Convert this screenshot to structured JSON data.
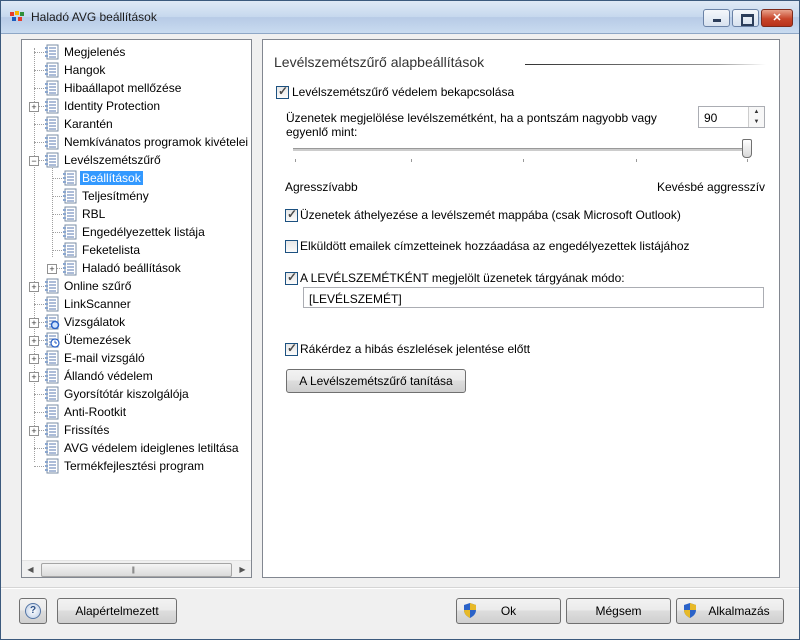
{
  "window": {
    "title": "Haladó AVG beállítások",
    "icon": "avg-logo-icon",
    "controls": [
      "minimize-icon",
      "maximize-icon",
      "close-icon"
    ]
  },
  "tree": {
    "items": [
      {
        "label": "Megjelenés",
        "icon": "settings-page-icon",
        "expander": ""
      },
      {
        "label": "Hangok",
        "icon": "settings-page-icon",
        "expander": ""
      },
      {
        "label": "Hibaállapot mellőzése",
        "icon": "settings-page-icon",
        "expander": ""
      },
      {
        "label": "Identity Protection",
        "icon": "settings-page-icon",
        "expander": "+"
      },
      {
        "label": "Karantén",
        "icon": "settings-page-icon",
        "expander": ""
      },
      {
        "label": "Nemkívánatos programok kivételei",
        "icon": "settings-page-icon",
        "expander": ""
      },
      {
        "label": "Levélszemétszűrő",
        "icon": "settings-page-icon",
        "expander": "−"
      },
      {
        "label": "Beállítások",
        "icon": "settings-page-icon",
        "expander": "",
        "selected": true
      },
      {
        "label": "Teljesítmény",
        "icon": "settings-page-icon",
        "expander": ""
      },
      {
        "label": "RBL",
        "icon": "settings-page-icon",
        "expander": ""
      },
      {
        "label": "Engedélyezettek listája",
        "icon": "settings-page-icon",
        "expander": ""
      },
      {
        "label": "Feketelista",
        "icon": "settings-page-icon",
        "expander": ""
      },
      {
        "label": "Haladó beállítások",
        "icon": "settings-page-icon",
        "expander": "+"
      },
      {
        "label": "Online szűrő",
        "icon": "settings-page-icon",
        "expander": "+"
      },
      {
        "label": "LinkScanner",
        "icon": "settings-page-icon",
        "expander": ""
      },
      {
        "label": "Vizsgálatok",
        "icon": "scan-icon",
        "expander": "+"
      },
      {
        "label": "Ütemezések",
        "icon": "schedule-icon",
        "expander": "+"
      },
      {
        "label": "E-mail vizsgáló",
        "icon": "settings-page-icon",
        "expander": "+"
      },
      {
        "label": "Állandó védelem",
        "icon": "settings-page-icon",
        "expander": "+"
      },
      {
        "label": "Gyorsítótár kiszolgálója",
        "icon": "settings-page-icon",
        "expander": ""
      },
      {
        "label": "Anti-Rootkit",
        "icon": "settings-page-icon",
        "expander": ""
      },
      {
        "label": "Frissítés",
        "icon": "settings-page-icon",
        "expander": "+"
      },
      {
        "label": "AVG védelem ideiglenes letiltása",
        "icon": "settings-page-icon",
        "expander": ""
      },
      {
        "label": "Termékfejlesztési program",
        "icon": "settings-page-icon",
        "expander": ""
      }
    ]
  },
  "main": {
    "section_title": "Levélszemétszűrő alapbeállítások",
    "enable_label": "Levélszemétszűrő védelem bekapcsolása",
    "enable_checked": true,
    "score_label_line1": "Üzenetek megjelölése levélszemétként, ha a pontszám nagyobb vagy",
    "score_label_line2": "egyenlő mint:",
    "score_value": "90",
    "slider_left_label": "Agresszívabb",
    "slider_right_label": "Kevésbé aggresszív",
    "slider_level": 1.0,
    "move_label": "Üzenetek áthelyezése a levélszemét mappába (csak Microsoft Outlook)",
    "move_checked": true,
    "add_recipients_label": "Elküldött emailek címzetteinek hozzáadása az engedélyezettek listájához",
    "add_recipients_checked": false,
    "modify_subject_label": "A LEVÉLSZEMÉTKÉNT megjelölt üzenetek tárgyának módo:",
    "modify_subject_checked": true,
    "subject_tag": "[LEVÉLSZEMÉT]",
    "ask_before_report_label": "Rákérdez a hibás észlelések jelentése előtt",
    "ask_before_report_checked": true,
    "learn_button": "A Levélszemétszűrő tanítása"
  },
  "footer": {
    "help_icon": "help-icon",
    "defaults_button": "Alapértelmezett",
    "ok_button": "Ok",
    "cancel_button": "Mégsem",
    "apply_button": "Alkalmazás",
    "shield_icon": "uac-shield-icon"
  }
}
